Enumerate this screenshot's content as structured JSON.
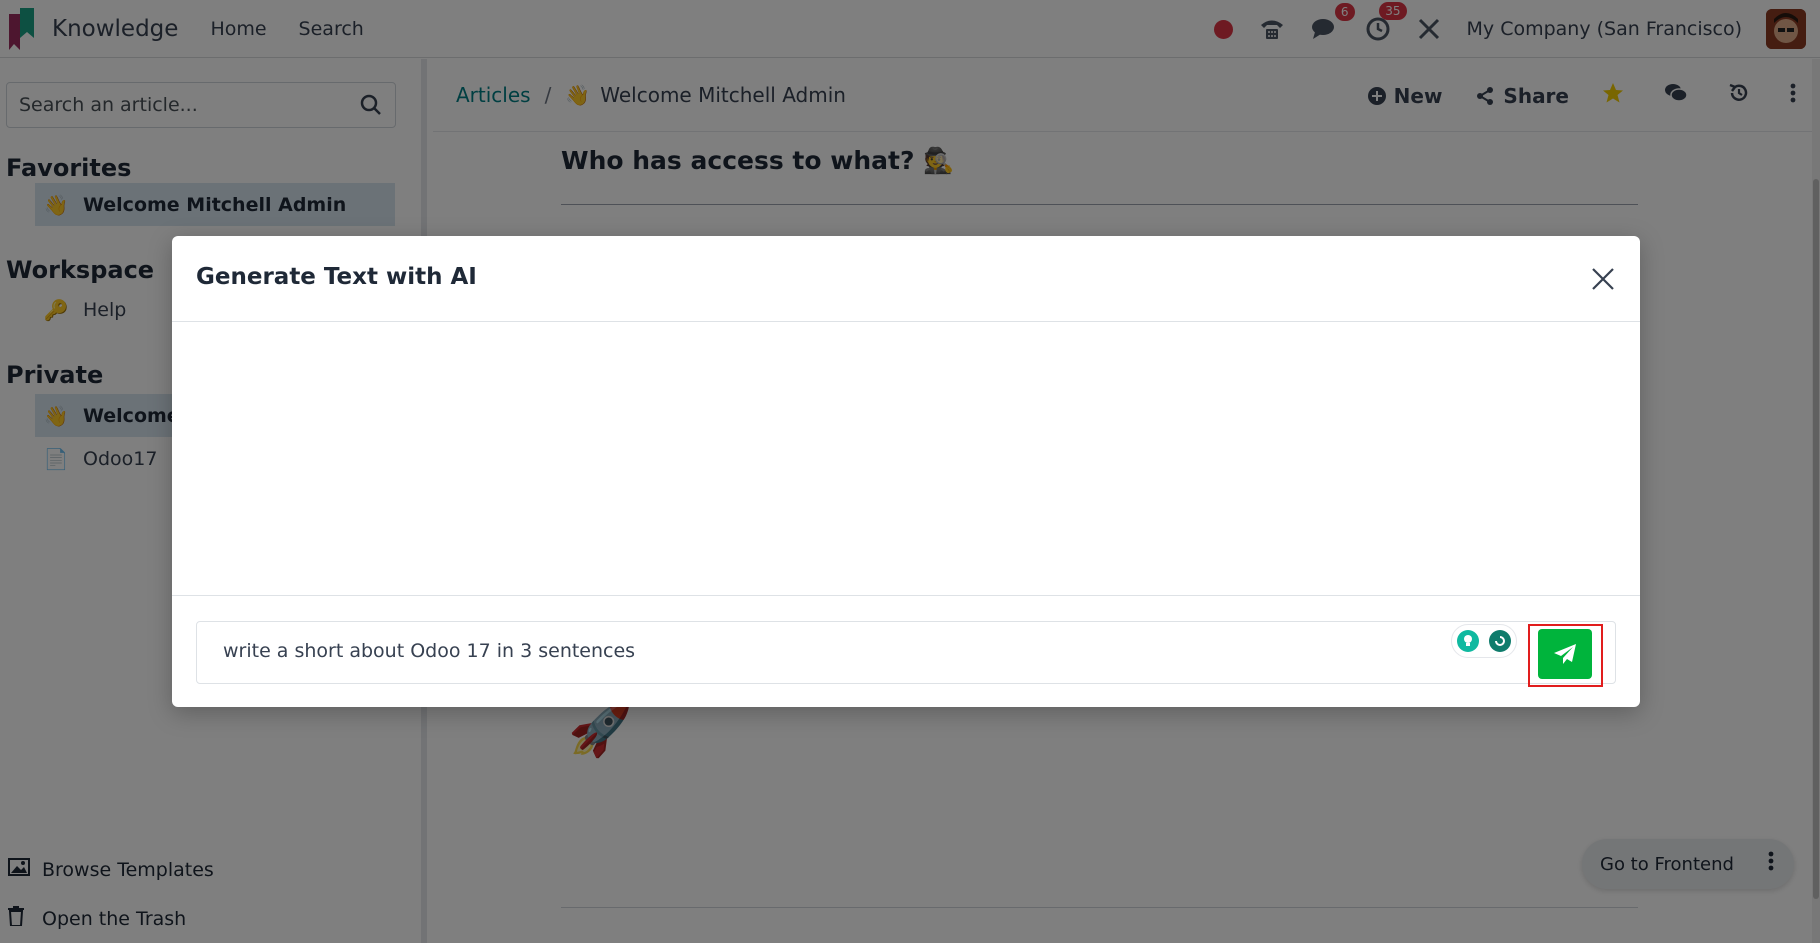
{
  "navbar": {
    "app_name": "Knowledge",
    "menu": [
      "Home",
      "Search"
    ],
    "messages_badge": "6",
    "activities_badge": "35",
    "company": "My Company (San Francisco)",
    "icons": [
      "recording-dot-icon",
      "phone-icon",
      "chat-icon",
      "clock-icon",
      "tools-icon"
    ]
  },
  "sidebar": {
    "search_placeholder": "Search an article...",
    "favorites_title": "Favorites",
    "favorites": [
      {
        "emoji": "👋",
        "label": "Welcome Mitchell Admin"
      }
    ],
    "workspace_title": "Workspace",
    "workspace": [
      {
        "emoji": "🔑",
        "label": "Help"
      }
    ],
    "private_title": "Private",
    "private": [
      {
        "emoji": "👋",
        "label": "Welcome"
      },
      {
        "emoji": "📄",
        "label": "Odoo17"
      }
    ],
    "browse_templates": "Browse Templates",
    "open_trash": "Open the Trash"
  },
  "content": {
    "breadcrumb_root": "Articles",
    "breadcrumb_sep": "/",
    "breadcrumb_emoji": "👋",
    "breadcrumb_current": "Welcome Mitchell Admin",
    "new_label": "New",
    "share_label": "Share",
    "article_heading": "Who has access to what? 🕵️",
    "rocket": "🚀",
    "go_to_frontend": "Go to Frontend"
  },
  "modal": {
    "title": "Generate Text with AI",
    "prompt_value": "write a short about Odoo 17 in 3 sentences"
  },
  "colors": {
    "accent": "#017e84",
    "send": "#00b43c",
    "highlight": "#e11d1d"
  }
}
